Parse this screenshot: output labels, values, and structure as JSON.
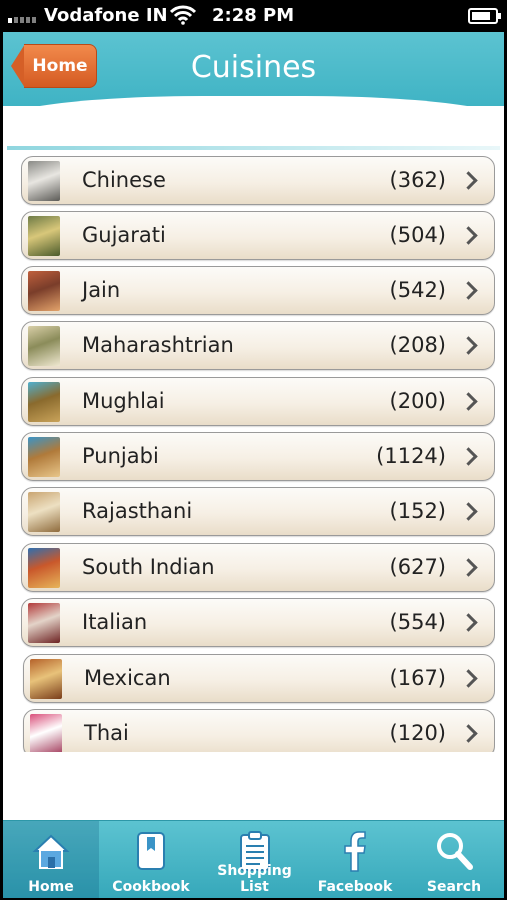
{
  "status_bar": {
    "carrier": "Vodafone IN",
    "time": "2:28 PM"
  },
  "header": {
    "title": "Cuisines",
    "back_label": "Home"
  },
  "cuisines": [
    {
      "name": "Chinese",
      "count": "(362)",
      "thumb_colors": [
        "#8a8a86",
        "#e8e6e1",
        "#5b5a56"
      ]
    },
    {
      "name": "Gujarati",
      "count": "(504)",
      "thumb_colors": [
        "#6d7a45",
        "#d8c77a",
        "#4b5b2b"
      ]
    },
    {
      "name": "Jain",
      "count": "(542)",
      "thumb_colors": [
        "#c0603d",
        "#7a3d2a",
        "#e3a36b"
      ]
    },
    {
      "name": "Maharashtrian",
      "count": "(208)",
      "thumb_colors": [
        "#d9cfa8",
        "#8b8c5a",
        "#efe8d0"
      ]
    },
    {
      "name": "Mughlai",
      "count": "(200)",
      "thumb_colors": [
        "#4fb0cf",
        "#8a6a2d",
        "#c9a35a"
      ]
    },
    {
      "name": "Punjabi",
      "count": "(1124)",
      "thumb_colors": [
        "#3a94c7",
        "#b07a3a",
        "#e8c68a"
      ]
    },
    {
      "name": "Rajasthani",
      "count": "(152)",
      "thumb_colors": [
        "#c9a571",
        "#ede0c2",
        "#8f6b3c"
      ]
    },
    {
      "name": "South Indian",
      "count": "(627)",
      "thumb_colors": [
        "#2e6fb0",
        "#c9582b",
        "#e7b55a"
      ]
    },
    {
      "name": "Italian",
      "count": "(554)",
      "thumb_colors": [
        "#b23a3a",
        "#e3d3c8",
        "#6d2222"
      ]
    },
    {
      "name": "Mexican",
      "count": "(167)",
      "thumb_colors": [
        "#b5622a",
        "#e8c27a",
        "#7a3d1a"
      ]
    },
    {
      "name": "Thai",
      "count": "(120)",
      "thumb_colors": [
        "#d94f7a",
        "#ffffff",
        "#a33c5c"
      ]
    }
  ],
  "tabs": [
    {
      "label": "Home",
      "icon": "home-icon",
      "active": true
    },
    {
      "label": "Cookbook",
      "icon": "cookbook-icon",
      "active": false
    },
    {
      "label": "Shopping List",
      "icon": "clipboard-icon",
      "active": false
    },
    {
      "label": "Facebook",
      "icon": "facebook-icon",
      "active": false
    },
    {
      "label": "Search",
      "icon": "search-icon",
      "active": false
    }
  ],
  "colors": {
    "accent": "#45b8c8",
    "back_button": "#e06b2f"
  }
}
